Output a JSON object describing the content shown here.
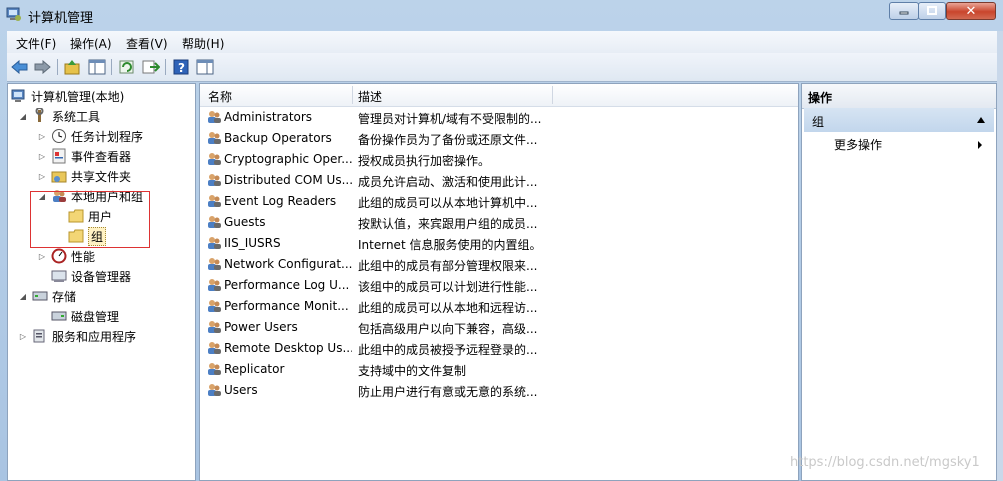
{
  "window": {
    "title": "计算机管理"
  },
  "menu": [
    "文件(F)",
    "操作(A)",
    "查看(V)",
    "帮助(H)"
  ],
  "toolbar": {
    "buttons": [
      "back-icon",
      "forward-icon",
      "up-icon",
      "show-hide-tree-icon",
      "refresh-icon",
      "export-icon",
      "help-icon",
      "show-hide-action-icon"
    ]
  },
  "tree": {
    "root": "计算机管理(本地)",
    "items": [
      {
        "label": "系统工具",
        "level": 1,
        "expander": "◢"
      },
      {
        "label": "任务计划程序",
        "level": 2,
        "expander": "▷"
      },
      {
        "label": "事件查看器",
        "level": 2,
        "expander": "▷"
      },
      {
        "label": "共享文件夹",
        "level": 2,
        "expander": "▷"
      },
      {
        "label": "本地用户和组",
        "level": 2,
        "expander": "◢"
      },
      {
        "label": "用户",
        "level": 3,
        "expander": ""
      },
      {
        "label": "组",
        "level": 3,
        "expander": ""
      },
      {
        "label": "性能",
        "level": 2,
        "expander": "▷"
      },
      {
        "label": "设备管理器",
        "level": 2,
        "expander": ""
      },
      {
        "label": "存储",
        "level": 1,
        "expander": "◢"
      },
      {
        "label": "磁盘管理",
        "level": 2,
        "expander": ""
      },
      {
        "label": "服务和应用程序",
        "level": 1,
        "expander": "▷"
      }
    ]
  },
  "list": {
    "headers": {
      "name": "名称",
      "desc": "描述"
    },
    "rows": [
      {
        "name": "Administrators",
        "desc": "管理员对计算机/域有不受限制的..."
      },
      {
        "name": "Backup Operators",
        "desc": "备份操作员为了备份或还原文件..."
      },
      {
        "name": "Cryptographic Oper...",
        "desc": "授权成员执行加密操作。"
      },
      {
        "name": "Distributed COM Us...",
        "desc": "成员允许启动、激活和使用此计..."
      },
      {
        "name": "Event Log Readers",
        "desc": "此组的成员可以从本地计算机中..."
      },
      {
        "name": "Guests",
        "desc": "按默认值，来宾跟用户组的成员..."
      },
      {
        "name": "IIS_IUSRS",
        "desc": "Internet 信息服务使用的内置组。"
      },
      {
        "name": "Network Configurat...",
        "desc": "此组中的成员有部分管理权限来..."
      },
      {
        "name": "Performance Log U...",
        "desc": "该组中的成员可以计划进行性能..."
      },
      {
        "name": "Performance Monit...",
        "desc": "此组的成员可以从本地和远程访..."
      },
      {
        "name": "Power Users",
        "desc": "包括高级用户以向下兼容，高级..."
      },
      {
        "name": "Remote Desktop Us...",
        "desc": "此组中的成员被授予远程登录的..."
      },
      {
        "name": "Replicator",
        "desc": "支持域中的文件复制"
      },
      {
        "name": "Users",
        "desc": "防止用户进行有意或无意的系统..."
      }
    ]
  },
  "actions": {
    "header": "操作",
    "group": "组",
    "more": "更多操作"
  },
  "watermark": "https://blog.csdn.net/mgsky1"
}
